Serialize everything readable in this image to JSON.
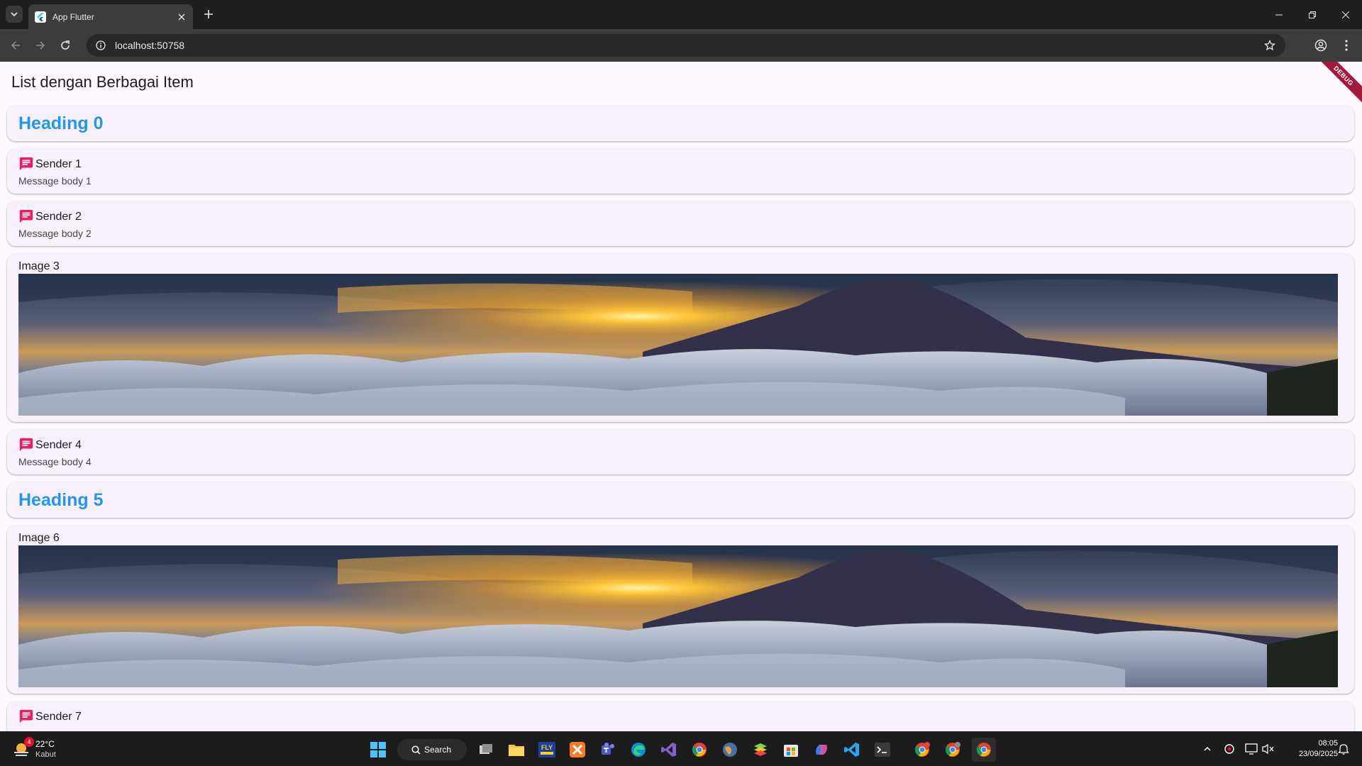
{
  "browser": {
    "tab_title": "App Flutter",
    "url": "localhost:50758"
  },
  "app": {
    "title": "List dengan Berbagai Item",
    "debug_banner": "DEBUG"
  },
  "list": {
    "heading0": "Heading 0",
    "sender1": {
      "sender": "Sender 1",
      "body": "Message body 1"
    },
    "sender2": {
      "sender": "Sender 2",
      "body": "Message body 2"
    },
    "image3": {
      "title": "Image 3"
    },
    "sender4": {
      "sender": "Sender 4",
      "body": "Message body 4"
    },
    "heading5": "Heading 5",
    "image6": {
      "title": "Image 6"
    },
    "sender7": {
      "sender": "Sender 7"
    }
  },
  "taskbar": {
    "weather_temp": "22°C",
    "weather_desc": "Kabut",
    "weather_badge": "4",
    "search_label": "Search",
    "time": "08:05",
    "date": "23/09/2025"
  },
  "colors": {
    "heading": "#2196f3",
    "message_icon": "#e91e63",
    "debug_banner": "#a4193d"
  }
}
